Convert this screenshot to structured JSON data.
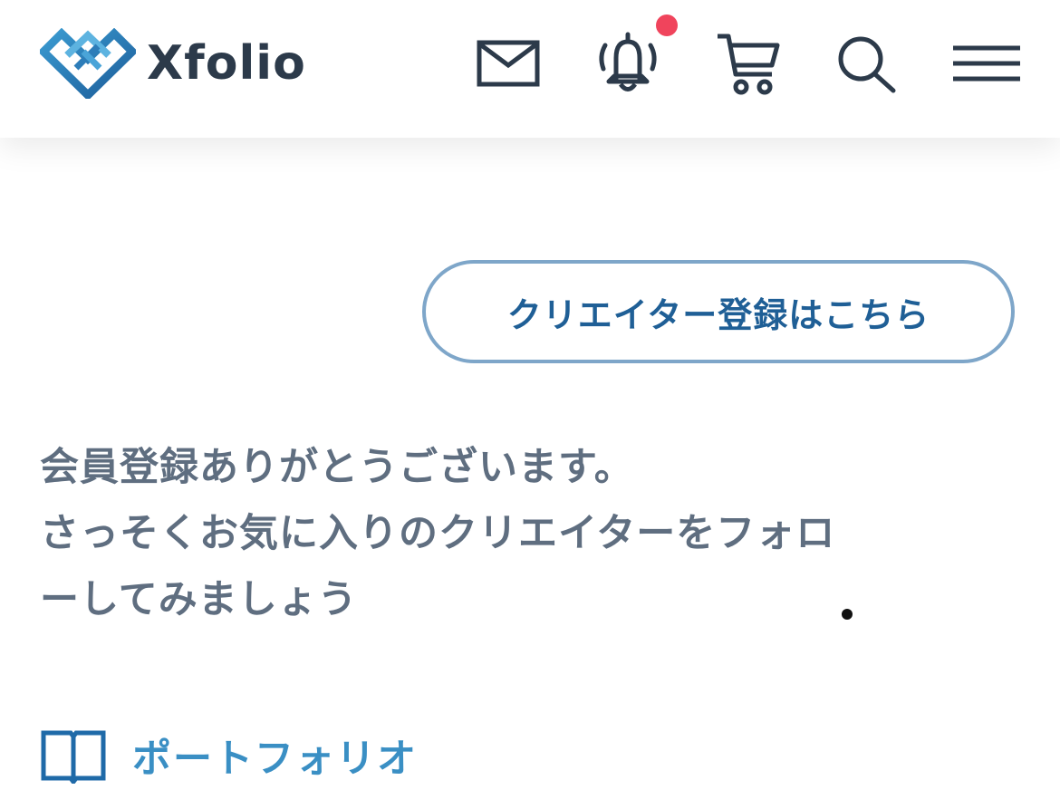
{
  "header": {
    "logo_text": "Xfolio",
    "icons": [
      "heart-diamond-logo",
      "mail-icon",
      "bell-icon",
      "cart-icon",
      "search-icon",
      "hamburger-menu-icon"
    ],
    "has_notification": true,
    "notification_color": "#f0445c"
  },
  "main": {
    "creator_signup_label": "クリエイター登録はこちら",
    "welcome_lines": [
      "会員登録ありがとうございます。",
      "さっそくお気に入りのクリエイターをフォロ",
      "ーしてみましょう"
    ],
    "portfolio_label": "ポートフォリオ"
  },
  "colors": {
    "accent": "#1f5f96",
    "button_border": "#7ea6c9",
    "text": "#5f6e80",
    "link": "#3a8fc4",
    "logo_text": "#2c3a4a"
  }
}
